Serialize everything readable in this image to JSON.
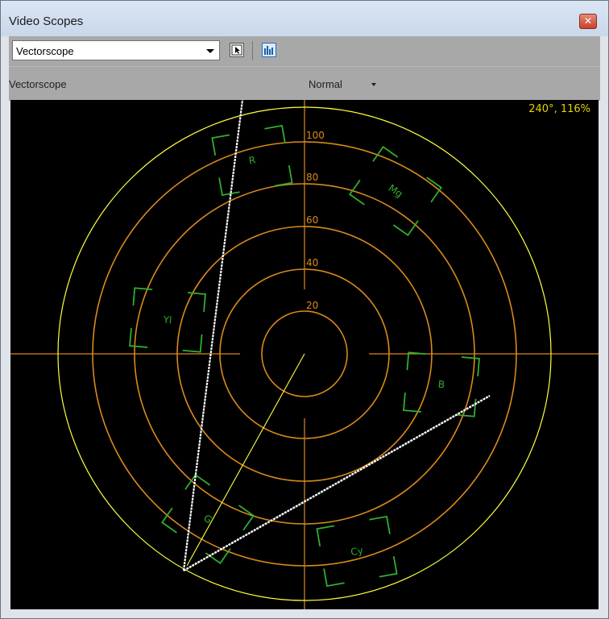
{
  "window": {
    "title": "Video Scopes"
  },
  "toolbar": {
    "scope_select_value": "Vectorscope"
  },
  "subheader": {
    "scope_name": "Vectorscope",
    "display_mode": "Normal"
  },
  "scope": {
    "readout": "240°, 116%",
    "ring_labels": [
      "20",
      "40",
      "60",
      "80",
      "100"
    ],
    "targets": [
      "R",
      "Mg",
      "Yl",
      "B",
      "G",
      "Cy"
    ]
  },
  "colors": {
    "graticule": "#d98a1c",
    "outer_circle": "#ffff3c",
    "targets": "#2fae2f",
    "readout": "#e6d200",
    "trace": "#ffffff"
  },
  "icons": {
    "close": "close-icon",
    "settings": "settings-icon",
    "levels": "levels-icon",
    "dropdown_arrow": "chevron-down-icon"
  }
}
